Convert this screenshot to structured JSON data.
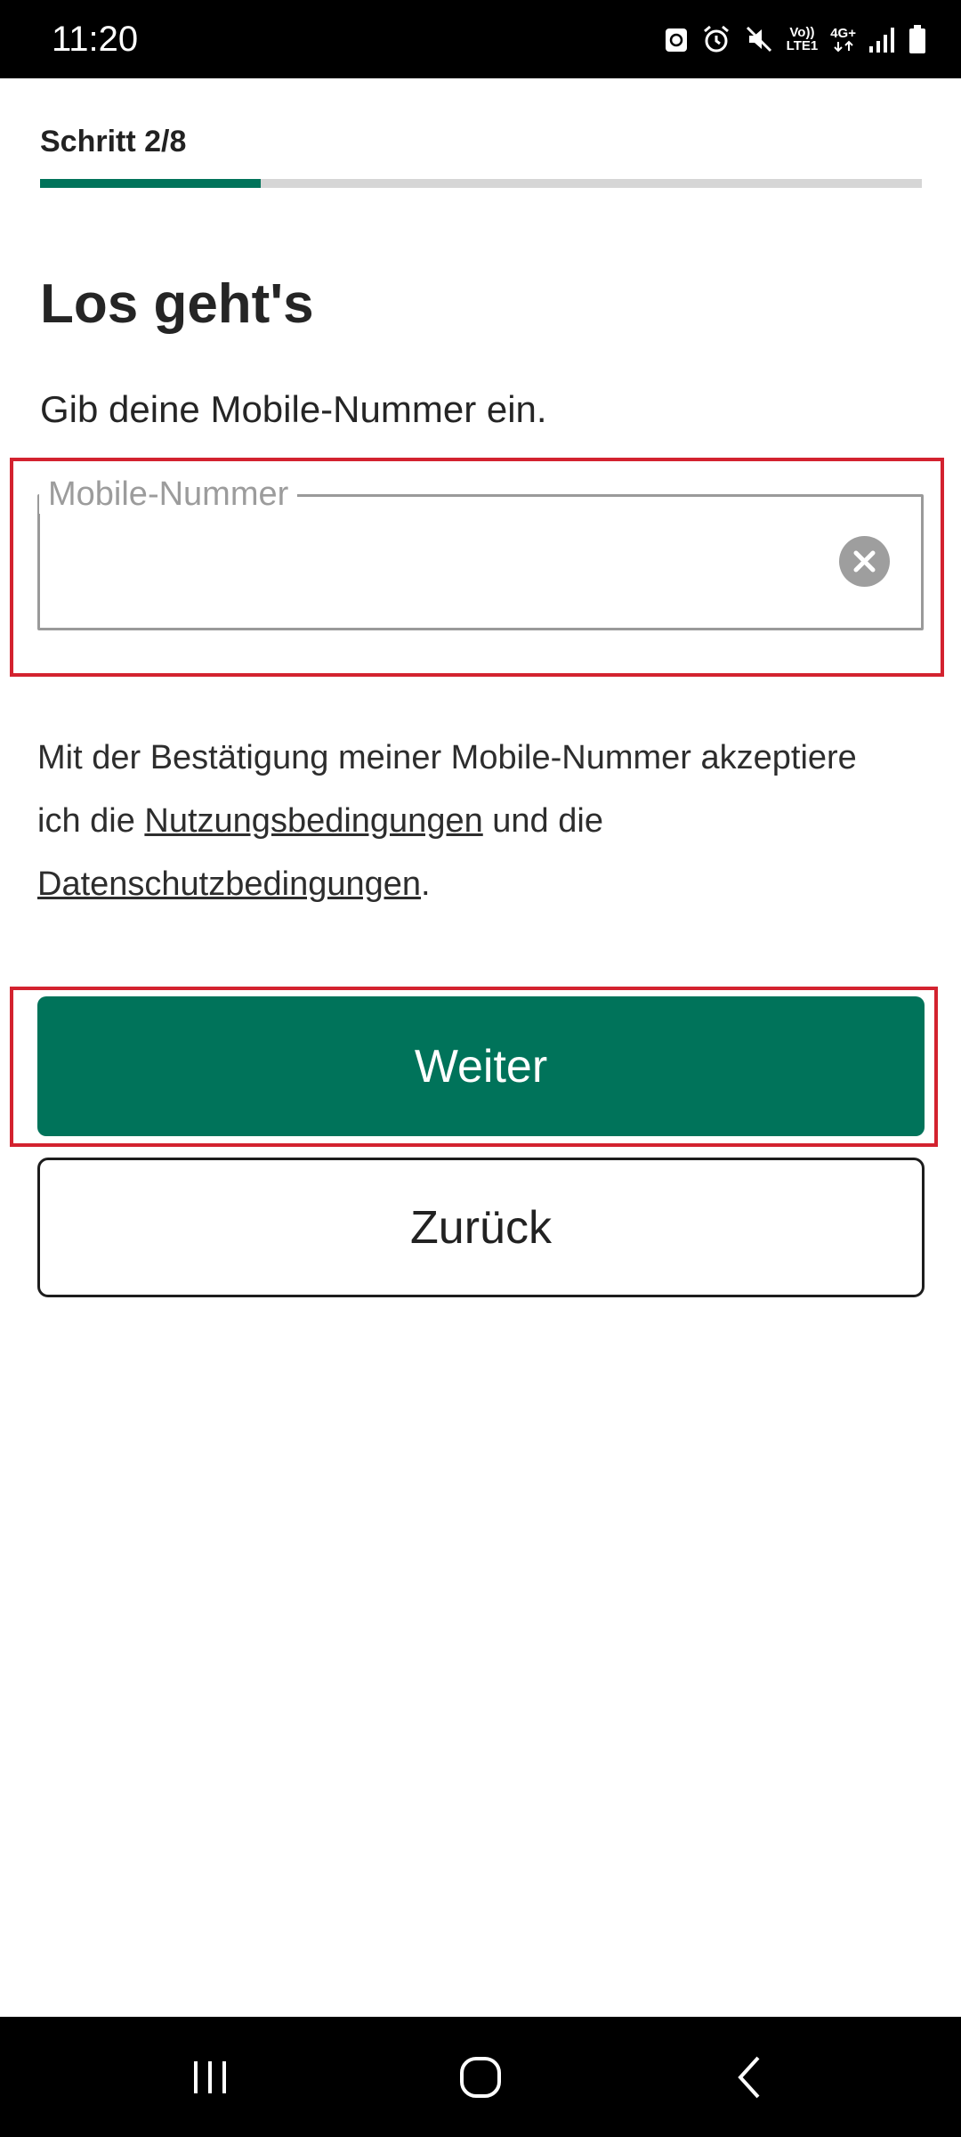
{
  "status_bar": {
    "time": "11:20",
    "icons": [
      "recycle-icon",
      "alarm-icon",
      "mute-icon",
      "volte-icon",
      "network-4g-icon",
      "signal-icon",
      "battery-icon"
    ],
    "volte_line1": "Vo))",
    "volte_line2": "LTE1",
    "network": "4G+"
  },
  "step": {
    "label": "Schritt 2/8",
    "current": 2,
    "total": 8
  },
  "title": "Los geht's",
  "subtitle": "Gib deine Mobile-Nummer ein.",
  "phone_field": {
    "label": "Mobile-Nummer",
    "value": ""
  },
  "legal": {
    "text_before": "Mit der Bestätigung meiner Mobile-Nummer akzeptiere ich die ",
    "terms_link": "Nutzungsbedingungen",
    "text_middle": " und die ",
    "privacy_link": "Datenschutzbedingungen",
    "text_after": "."
  },
  "buttons": {
    "next": "Weiter",
    "back": "Zurück"
  },
  "colors": {
    "primary": "#00735a",
    "highlight": "#d3222f",
    "track": "#d6d6d6"
  },
  "nav_bar": {
    "icons": [
      "recent-apps-icon",
      "home-icon",
      "back-icon"
    ]
  }
}
